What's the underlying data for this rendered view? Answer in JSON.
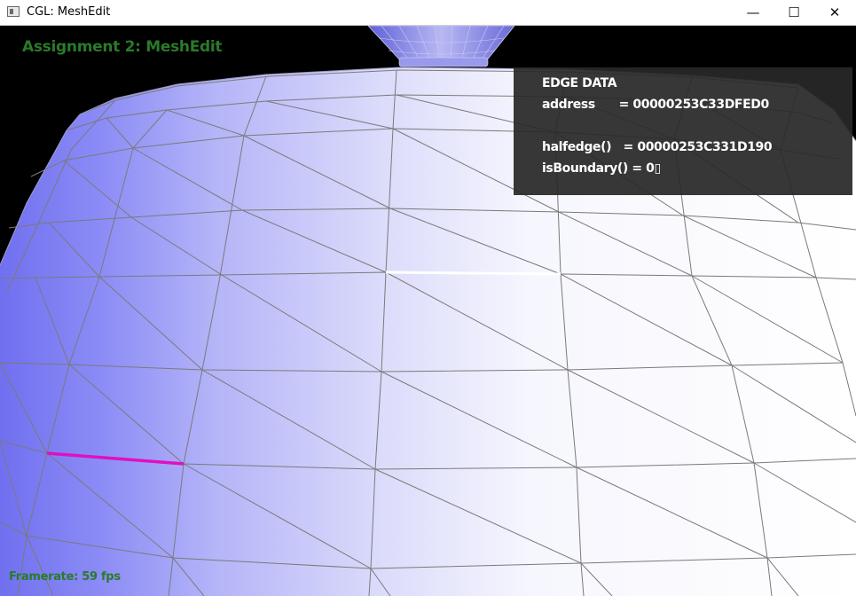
{
  "window": {
    "title": "CGL: MeshEdit",
    "minimize_glyph": "—",
    "maximize_glyph": "☐",
    "close_glyph": "✕"
  },
  "hud": {
    "title": "Assignment 2: MeshEdit",
    "framerate": "Framerate: 59 fps"
  },
  "edge_data": {
    "heading": "EDGE DATA",
    "address_line": "address      = 00000253C33DFED0",
    "halfedge_line": "halfedge()   = 00000253C331D190",
    "boundary_line": "isBoundary() = 0▯"
  },
  "colors": {
    "background": "#000000",
    "hud_text": "#2a7a2a",
    "selected_edge": "#e010c0",
    "mesh_wire": "#7a7a7a",
    "panel_bg": "#282828"
  }
}
